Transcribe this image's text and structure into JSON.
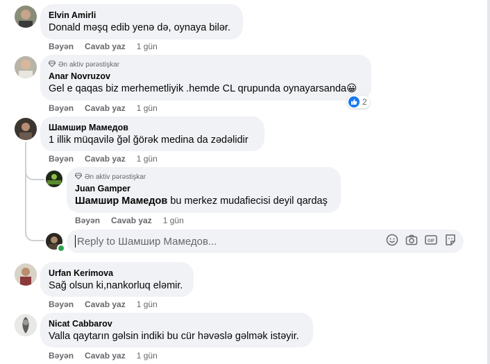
{
  "comments": [
    {
      "author": "Elvin Amirli",
      "text": "Donald məşq edib yenə də, oynaya bilər.",
      "actions": {
        "like": "Bəyən",
        "reply": "Cavab yaz",
        "time": "1 gün"
      }
    },
    {
      "badge": "Ən aktiv pərəstişkar",
      "author": "Anar Novruzov",
      "text": "Gel e qaqas biz merhemetliyik .hemde CL qrupunda oynayarsanda😀",
      "reaction_count": "2",
      "actions": {
        "like": "Bəyən",
        "reply": "Cavab yaz",
        "time": "1 gün"
      }
    },
    {
      "author": "Шамшир Мамедов",
      "text": "1 illik müqavilə ğəl ğörək medina da zədəlidir",
      "actions": {
        "like": "Bəyən",
        "reply": "Cavab yaz",
        "time": "1 gün"
      }
    },
    {
      "author": "Urfan Kerimova",
      "text": "Sağ olsun ki,nankorluq eləmir.",
      "actions": {
        "like": "Bəyən",
        "reply": "Cavab yaz",
        "time": "1 gün"
      }
    },
    {
      "author": "Nicat Cabbarov",
      "text": "Valla qaytarın gəlsin indiki bu cür həvəslə gəlmək istəyir.",
      "actions": {
        "like": "Bəyən",
        "reply": "Cavab yaz",
        "time": "1 gün"
      }
    }
  ],
  "reply": {
    "badge": "Ən aktiv pərəstişkar",
    "author": "Juan Gamper",
    "mention": "Шамшир Мамедов",
    "text": " bu merkez mudafiecisi deyil qardaş",
    "actions": {
      "like": "Bəyən",
      "reply": "Cavab yaz",
      "time": "1 gün"
    }
  },
  "reply_input": {
    "placeholder": "Reply to Шамшир Мамедов...",
    "icons": [
      "emoji-icon",
      "camera-icon",
      "gif-icon",
      "sticker-icon"
    ]
  },
  "colors": {
    "bubble": "#f0f2f5",
    "secondary_text": "#65676b",
    "like_blue": "#1877f2",
    "online_green": "#31a24c"
  }
}
